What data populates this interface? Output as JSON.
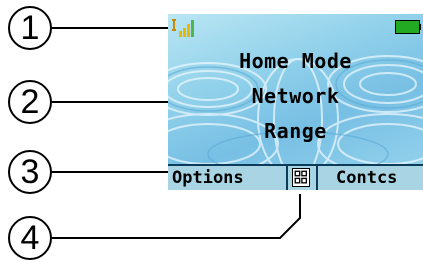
{
  "callouts": [
    "1",
    "2",
    "3",
    "4"
  ],
  "screen": {
    "message_lines": [
      "Home Mode",
      "Network",
      "Range"
    ],
    "softkeys": {
      "left": "Options",
      "center_icon": "menu-grid-icon",
      "right": "Contcs"
    },
    "status_icons": [
      "signal-strength-icon",
      "battery-icon"
    ]
  },
  "colors": {
    "screen_background": "#8fd0ea",
    "softkey_bar": "#a9d4e4",
    "signal_icon": "#d4a20a",
    "battery_icon": "#22aa22"
  }
}
